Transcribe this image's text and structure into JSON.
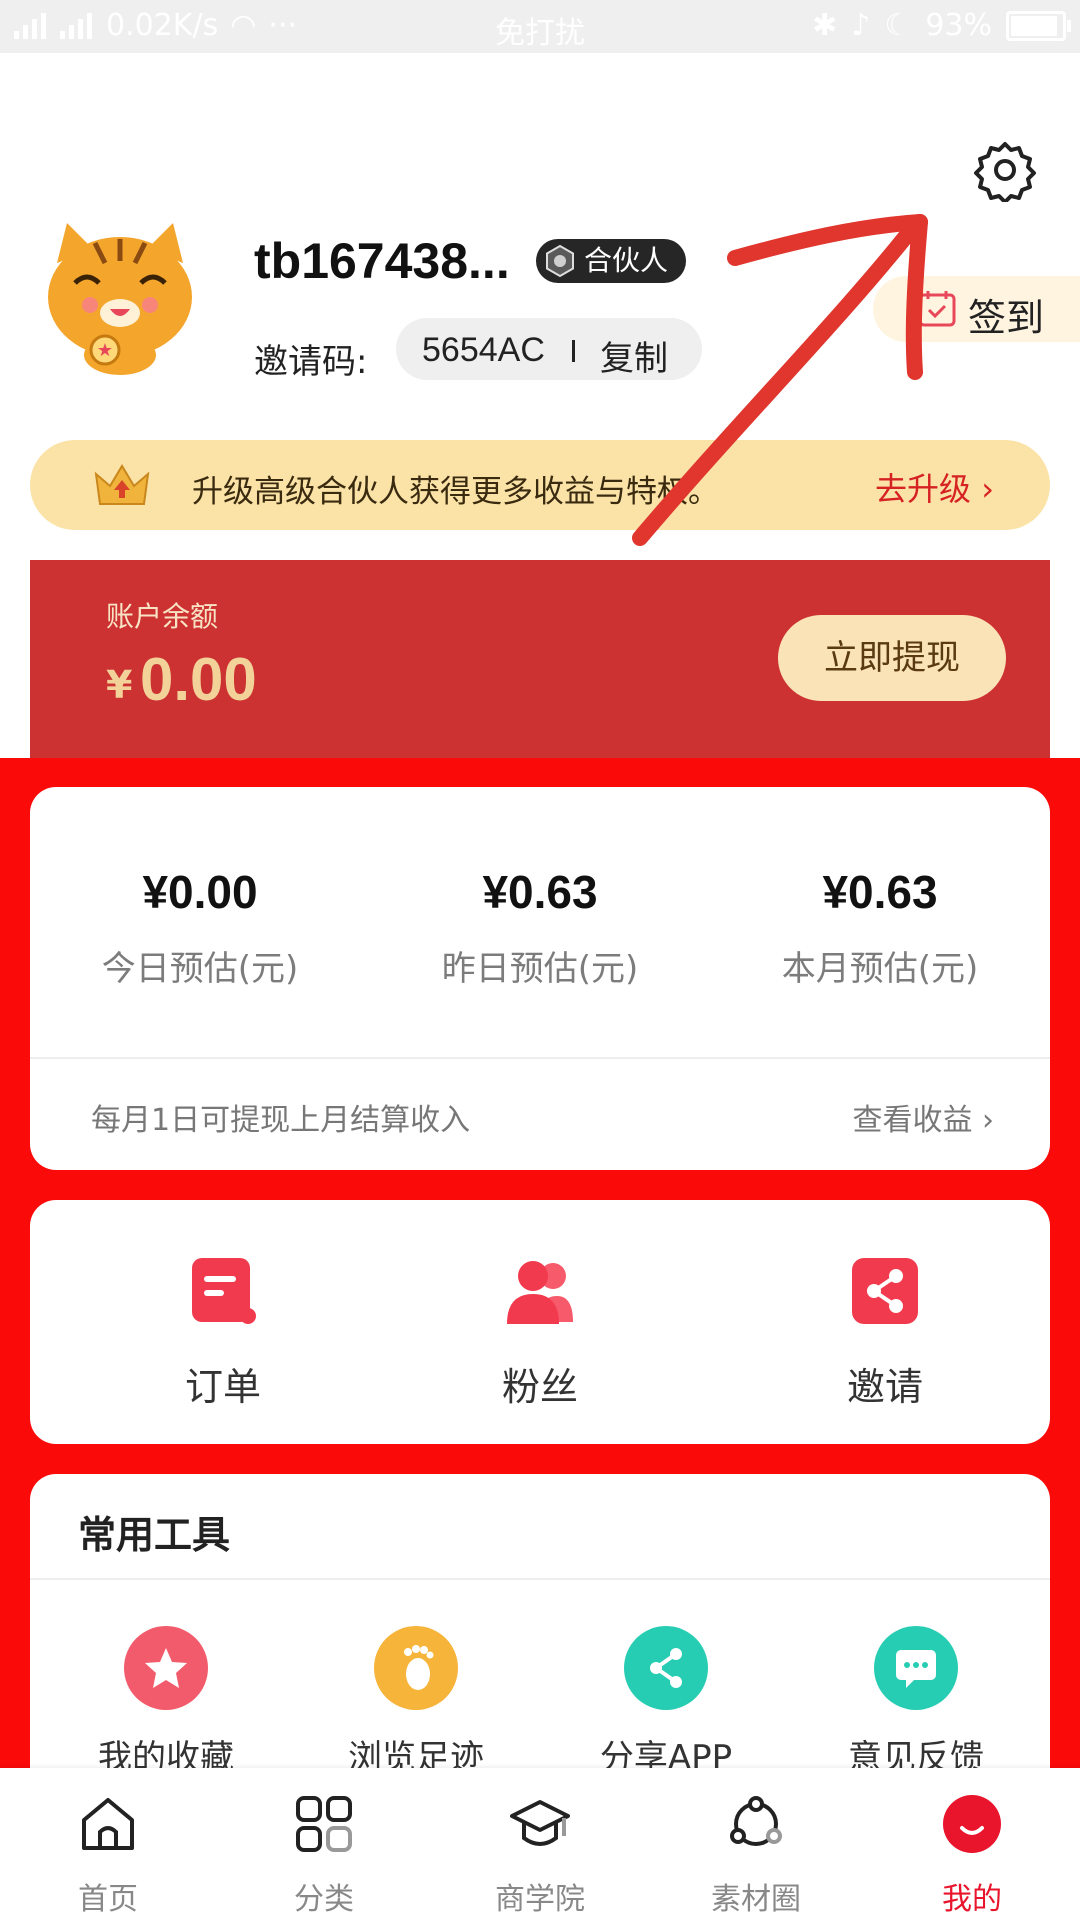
{
  "status_bar": {
    "network_speed": "0.02K/s",
    "more": "···",
    "mode": "免打扰",
    "battery": "93%"
  },
  "profile": {
    "username": "tb167438...",
    "badge": "合伙人",
    "invite_label": "邀请码:",
    "invite_code": "5654AC",
    "copy_label": "复制",
    "checkin_label": "签到"
  },
  "upgrade_banner": {
    "text": "升级高级合伙人获得更多收益与特权。",
    "action": "去升级"
  },
  "balance": {
    "label": "账户余额",
    "currency": "¥",
    "amount": "0.00",
    "withdraw_button": "立即提现"
  },
  "earnings": {
    "stats": [
      {
        "value": "¥0.00",
        "label": "今日预估(元)"
      },
      {
        "value": "¥0.63",
        "label": "昨日预估(元)"
      },
      {
        "value": "¥0.63",
        "label": "本月预估(元)"
      }
    ],
    "note": "每月1日可提现上月结算收入",
    "view_link": "查看收益"
  },
  "actions": [
    {
      "label": "订单",
      "icon": "order-icon"
    },
    {
      "label": "粉丝",
      "icon": "fans-icon"
    },
    {
      "label": "邀请",
      "icon": "share-invite-icon"
    }
  ],
  "tools": {
    "title": "常用工具",
    "items": [
      {
        "label": "我的收藏",
        "icon": "star-icon",
        "color": "#f25b6b"
      },
      {
        "label": "浏览足迹",
        "icon": "footprint-icon",
        "color": "#f7b43a"
      },
      {
        "label": "分享APP",
        "icon": "share-icon",
        "color": "#27cdb3"
      },
      {
        "label": "意见反馈",
        "icon": "chat-icon",
        "color": "#27cdb3"
      }
    ]
  },
  "bottom_nav": [
    {
      "label": "首页",
      "icon": "home-icon"
    },
    {
      "label": "分类",
      "icon": "category-icon"
    },
    {
      "label": "商学院",
      "icon": "academy-icon"
    },
    {
      "label": "素材圈",
      "icon": "material-icon"
    },
    {
      "label": "我的",
      "icon": "profile-icon",
      "active": true
    }
  ],
  "colors": {
    "brand_red": "#fb0a0a",
    "balance_red": "#cc3232",
    "gold": "#f3d29a",
    "active_nav": "#e8152c"
  }
}
